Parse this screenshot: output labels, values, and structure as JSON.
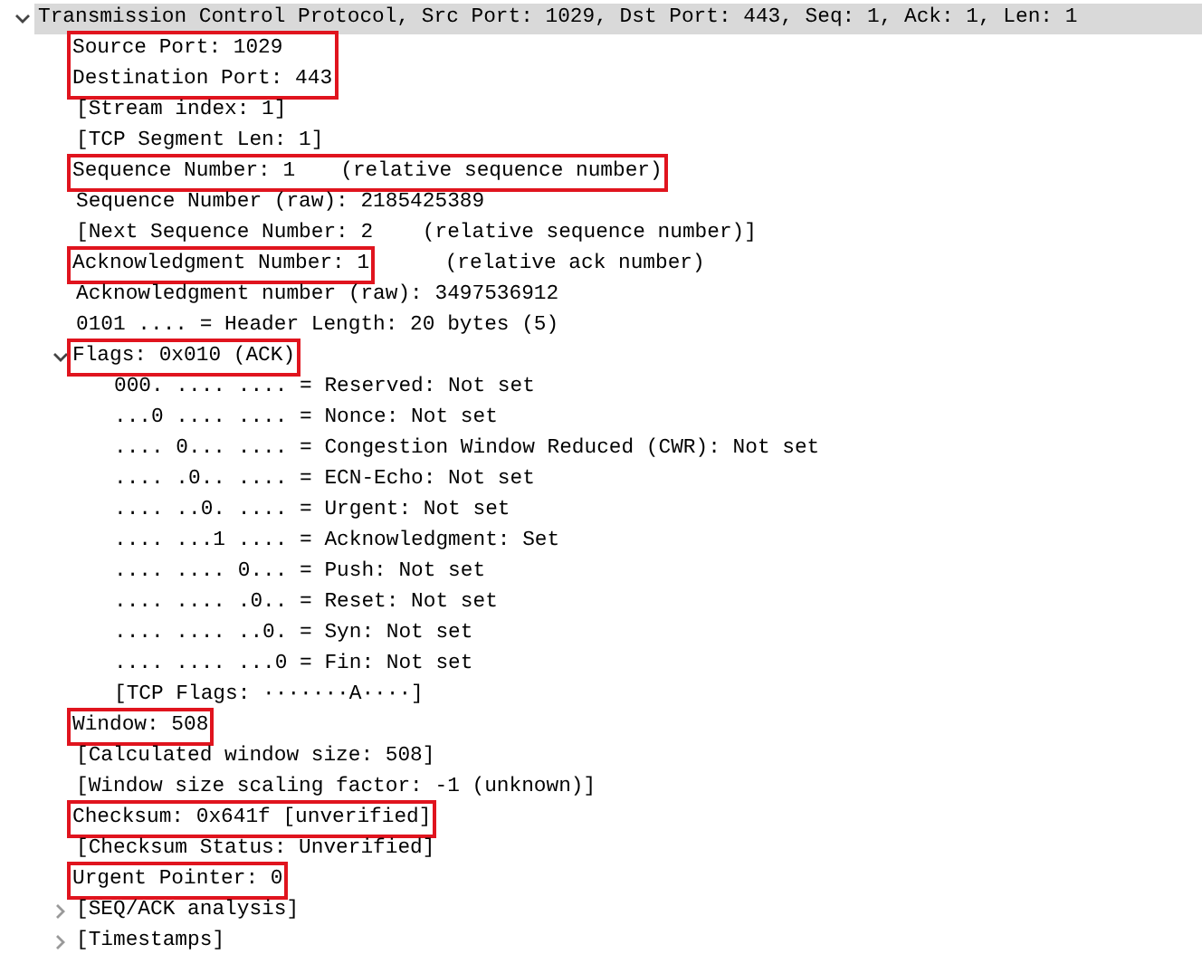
{
  "tree": [
    {
      "text": "Transmission Control Protocol, Src Port: 1029, Dst Port: 443, Seq: 1, Ack: 1, Len: 1",
      "expanded": true,
      "selected": true,
      "highlighted": false,
      "children": [
        {
          "text": "Source Port: 1029",
          "highlighted": true
        },
        {
          "text": "Destination Port: 443",
          "highlighted": true
        },
        {
          "text": "[Stream index: 1]",
          "highlighted": false
        },
        {
          "text": "[TCP Segment Len: 1]",
          "highlighted": false
        },
        {
          "text": "Sequence Number: 1",
          "note": "(relative sequence number)",
          "highlighted": true,
          "note_highlighted": true
        },
        {
          "text": "Sequence Number (raw): 2185425389",
          "highlighted": false
        },
        {
          "text": "[Next Sequence Number: 2    (relative sequence number)]",
          "highlighted": false
        },
        {
          "text": "Acknowledgment Number: 1",
          "note": "(relative ack number)",
          "highlighted": true,
          "note_highlighted": false
        },
        {
          "text": "Acknowledgment number (raw): 3497536912",
          "highlighted": false
        },
        {
          "text": "0101 .... = Header Length: 20 bytes (5)",
          "highlighted": false
        },
        {
          "text": "Flags: 0x010 (ACK)",
          "expanded": true,
          "highlighted": true,
          "children": [
            {
              "text": "000. .... .... = Reserved: Not set",
              "highlighted": false
            },
            {
              "text": "...0 .... .... = Nonce: Not set",
              "highlighted": false
            },
            {
              "text": ".... 0... .... = Congestion Window Reduced (CWR): Not set",
              "highlighted": false
            },
            {
              "text": ".... .0.. .... = ECN-Echo: Not set",
              "highlighted": false
            },
            {
              "text": ".... ..0. .... = Urgent: Not set",
              "highlighted": false
            },
            {
              "text": ".... ...1 .... = Acknowledgment: Set",
              "highlighted": false
            },
            {
              "text": ".... .... 0... = Push: Not set",
              "highlighted": false
            },
            {
              "text": ".... .... .0.. = Reset: Not set",
              "highlighted": false
            },
            {
              "text": ".... .... ..0. = Syn: Not set",
              "highlighted": false
            },
            {
              "text": ".... .... ...0 = Fin: Not set",
              "highlighted": false
            },
            {
              "text": "[TCP Flags: ·······A····]",
              "highlighted": false
            }
          ]
        },
        {
          "text": "Window: 508",
          "highlighted": true
        },
        {
          "text": "[Calculated window size: 508]",
          "highlighted": false
        },
        {
          "text": "[Window size scaling factor: -1 (unknown)]",
          "highlighted": false
        },
        {
          "text": "Checksum: 0x641f [unverified]",
          "highlighted": true
        },
        {
          "text": "[Checksum Status: Unverified]",
          "highlighted": false
        },
        {
          "text": "Urgent Pointer: 0",
          "highlighted": true
        },
        {
          "text": "[SEQ/ACK analysis]",
          "expanded": false,
          "highlighted": false
        },
        {
          "text": "[Timestamps]",
          "expanded": false,
          "highlighted": false
        }
      ]
    }
  ]
}
